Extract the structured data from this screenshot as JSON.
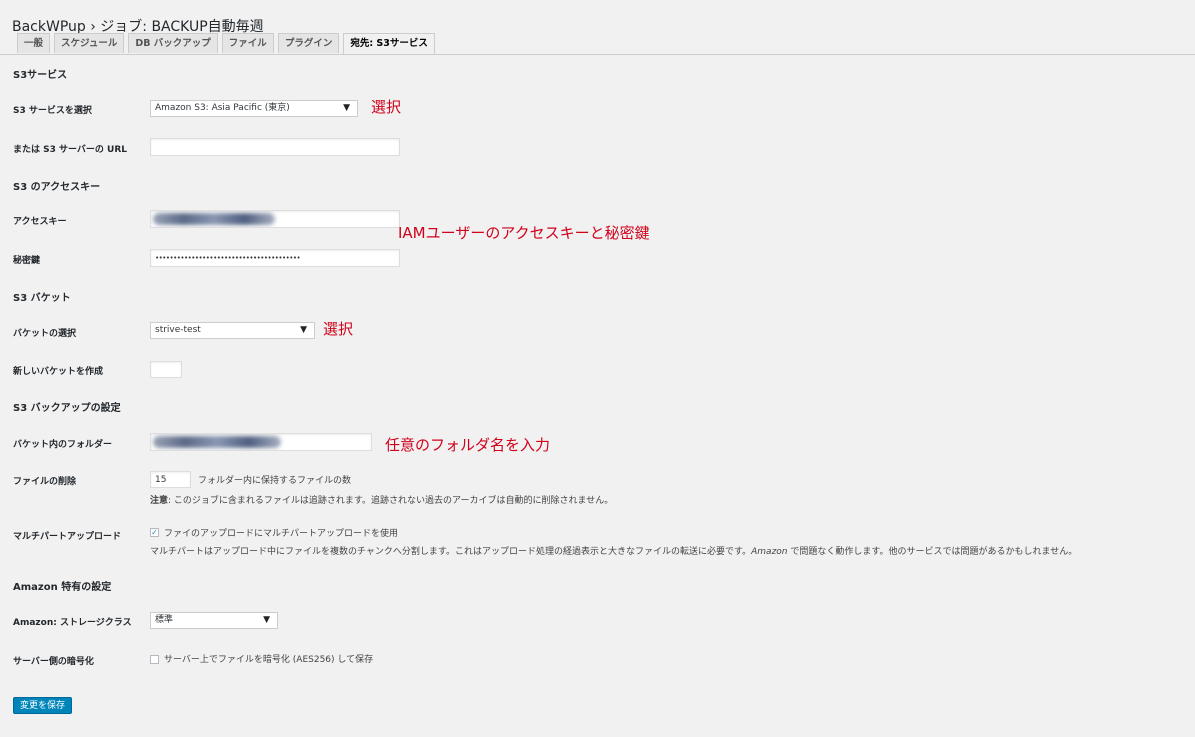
{
  "page_title": "BackWPup › ジョブ: BACKUP自動毎週",
  "tabs": [
    "一般",
    "スケジュール",
    "DB バックアップ",
    "ファイル",
    "プラグイン",
    "宛先: S3サービス"
  ],
  "sections": {
    "s3_service": "S3サービス",
    "access_key": "S3 のアクセスキー",
    "bucket": "S3 バケット",
    "backup_settings": "S3 バックアップの設定",
    "amazon": "Amazon 特有の設定"
  },
  "fields": {
    "s3_service_select": {
      "label": "S3 サービスを選択",
      "value": "Amazon S3: Asia Pacific (東京)"
    },
    "s3_server_url": {
      "label": "または S3 サーバーの URL",
      "value": ""
    },
    "access_key": {
      "label": "アクセスキー"
    },
    "secret_key": {
      "label": "秘密鍵",
      "value": "••••••••••••••••••••••••••••••••••••••••"
    },
    "bucket_select": {
      "label": "バケットの選択",
      "value": "strive-test"
    },
    "new_bucket": {
      "label": "新しいバケットを作成",
      "value": ""
    },
    "bucket_folder": {
      "label": "バケット内のフォルダー"
    },
    "file_delete": {
      "label": "ファイルの削除",
      "value": "15",
      "suffix": "フォルダー内に保持するファイルの数",
      "note_strong": "注意",
      "note": ": このジョブに含まれるファイルは追跡されます。追跡されない過去のアーカイブは自動的に削除されません。"
    },
    "multipart": {
      "label": "マルチパートアップロード",
      "checked": true,
      "checkbox_label": "ファイのアップロードにマルチパートアップロードを使用",
      "desc_a": "マルチパートはアップロード中にファイルを複数のチャンクへ分割します。これはアップロード処理の経過表示と大きなファイルの転送に必要です。",
      "desc_em": "Amazon",
      "desc_b": " で問題なく動作します。他のサービスでは問題があるかもしれません。"
    },
    "storage_class": {
      "label": "Amazon: ストレージクラス",
      "value": "標準"
    },
    "sse": {
      "label": "サーバー側の暗号化",
      "checked": false,
      "checkbox_label": "サーバー上でファイルを暗号化 (AES256) して保存"
    }
  },
  "annotations": {
    "select_1": "選択",
    "keys": "IAMユーザーのアクセスキーと秘密鍵",
    "select_2": "選択",
    "folder": "任意のフォルダ名を入力"
  },
  "save_button": "変更を保存",
  "colors": {
    "annotation": "#d0021b",
    "primary_button": "#0085ba"
  }
}
